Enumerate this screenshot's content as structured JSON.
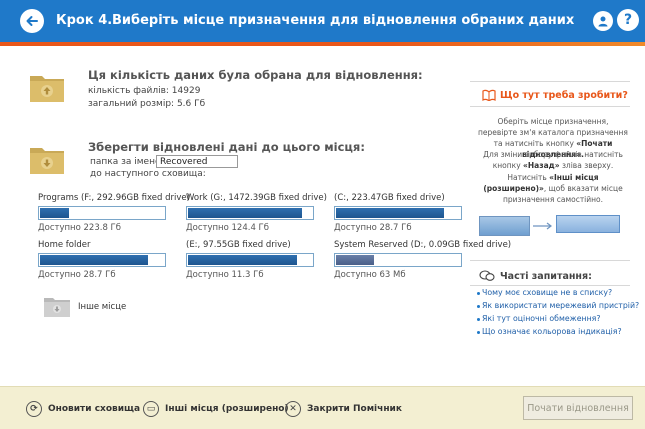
{
  "header": {
    "step": "Крок 4.",
    "title": "Виберіть місце призначення для відновлення обраних даних",
    "help_glyph": "?"
  },
  "selected": {
    "title": "Ця кількість даних була обрана для відновлення:",
    "files_label": "кількість файлів: 14929",
    "size_label": "загальний розмір: 5.6 Гб"
  },
  "destination": {
    "title": "Зберегти відновлені дані до цього місця:",
    "folder_label": "папка за іменем:",
    "folder_value": "Recovered",
    "storage_label": "до наступного сховища:"
  },
  "drives": [
    {
      "name": "Programs (F:, 292.96GB fixed drive)",
      "free": "Доступно 223.8 Гб",
      "used_fraction": 0.23,
      "style": "blue"
    },
    {
      "name": "Work (G:, 1472.39GB fixed drive)",
      "free": "Доступно 124.4 Гб",
      "used_fraction": 0.92,
      "style": "blue"
    },
    {
      "name": "(C:, 223.47GB fixed drive)",
      "free": "Доступно 28.7 Гб",
      "used_fraction": 0.87,
      "style": "blue"
    },
    {
      "name": "Home folder",
      "free": "Доступно 28.7 Гб",
      "used_fraction": 0.87,
      "style": "blue"
    },
    {
      "name": "(E:, 97.55GB fixed drive)",
      "free": "Доступно 11.3 Гб",
      "used_fraction": 0.88,
      "style": "blue"
    },
    {
      "name": "System Reserved (D:, 0.09GB fixed drive)",
      "free": "Доступно 63 Мб",
      "used_fraction": 0.31,
      "style": "gray"
    }
  ],
  "other_place": "Інше місце",
  "help_panel": {
    "title": "Що тут треба зробити?",
    "p1_a": "Оберіть місце призначення, перевірте зм'я каталога призначення та натисніть кнопку",
    "p1_b": "«Почати відновлення».",
    "p2_a": "Для зміни вибору файлів натисніть кнопку",
    "p2_b": "«Назад»",
    "p2_c": "зліва зверху.",
    "p3_a": "Натисніть",
    "p3_b": "«Інші місця (розширено)»",
    "p3_c": ", щоб вказати місце призначення самостійно."
  },
  "faq": {
    "title": "Часті запитання:",
    "items": [
      "Чому моє сховище не в списку?",
      "Як використати мережевий пристрій?",
      "Які тут оціночні обмеження?",
      "Що означає кольорова індикація?"
    ]
  },
  "footer": {
    "refresh": "Оновити сховища",
    "other_places": "Інші місця (розширено)",
    "close": "Закрити Помічник",
    "start": "Почати відновлення"
  },
  "colors": {
    "header": "#1f79c9",
    "accent": "#e8571a",
    "drive_fill": "#2f6fb0",
    "footer": "#f3efd2"
  }
}
